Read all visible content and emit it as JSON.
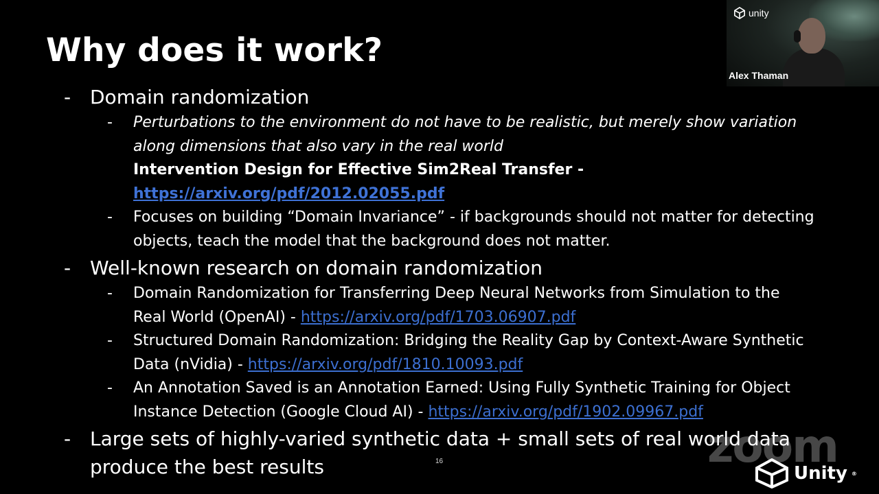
{
  "slide": {
    "title": "Why does it work?",
    "page_number": "16"
  },
  "bullets": {
    "b1": {
      "dash": "-",
      "text": "Domain randomization",
      "sub1": {
        "dash": "-",
        "line1": "Perturbations to the environment do not have to be realistic, but merely show variation",
        "line2": "along dimensions that also vary in the real world",
        "ref_title": "Intervention Design for Effective Sim2Real Transfer -",
        "ref_link": "https://arxiv.org/pdf/2012.02055.pdf"
      },
      "sub2": {
        "dash": "-",
        "line1": "Focuses on building “Domain Invariance” - if backgrounds should not matter for detecting",
        "line2": "objects, teach the model that the background does not matter."
      }
    },
    "b2": {
      "dash": "-",
      "text": "Well-known research on domain randomization",
      "sub1": {
        "dash": "-",
        "line1": "Domain Randomization for Transferring Deep Neural Networks from Simulation to the",
        "line2_prefix": "Real World (OpenAI) - ",
        "link": "https://arxiv.org/pdf/1703.06907.pdf"
      },
      "sub2": {
        "dash": "-",
        "line1": "Structured Domain Randomization: Bridging the Reality Gap by Context-Aware Synthetic",
        "line2_prefix": "Data (nVidia) - ",
        "link": "https://arxiv.org/pdf/1810.10093.pdf"
      },
      "sub3": {
        "dash": "-",
        "line1": "An Annotation Saved is an Annotation Earned: Using Fully Synthetic Training for Object",
        "line2_prefix": "Instance Detection (Google Cloud AI) - ",
        "link": "https://arxiv.org/pdf/1902.09967.pdf"
      }
    },
    "b3": {
      "dash": "-",
      "line1": "Large sets of highly-varied synthetic data + small sets of real world data",
      "line2": "produce the best results"
    }
  },
  "webcam": {
    "logo_text": "unity",
    "participant_name": "Alex Thaman"
  },
  "watermarks": {
    "zoom": "zoom",
    "unity": "Unity",
    "unity_mark": "®"
  }
}
